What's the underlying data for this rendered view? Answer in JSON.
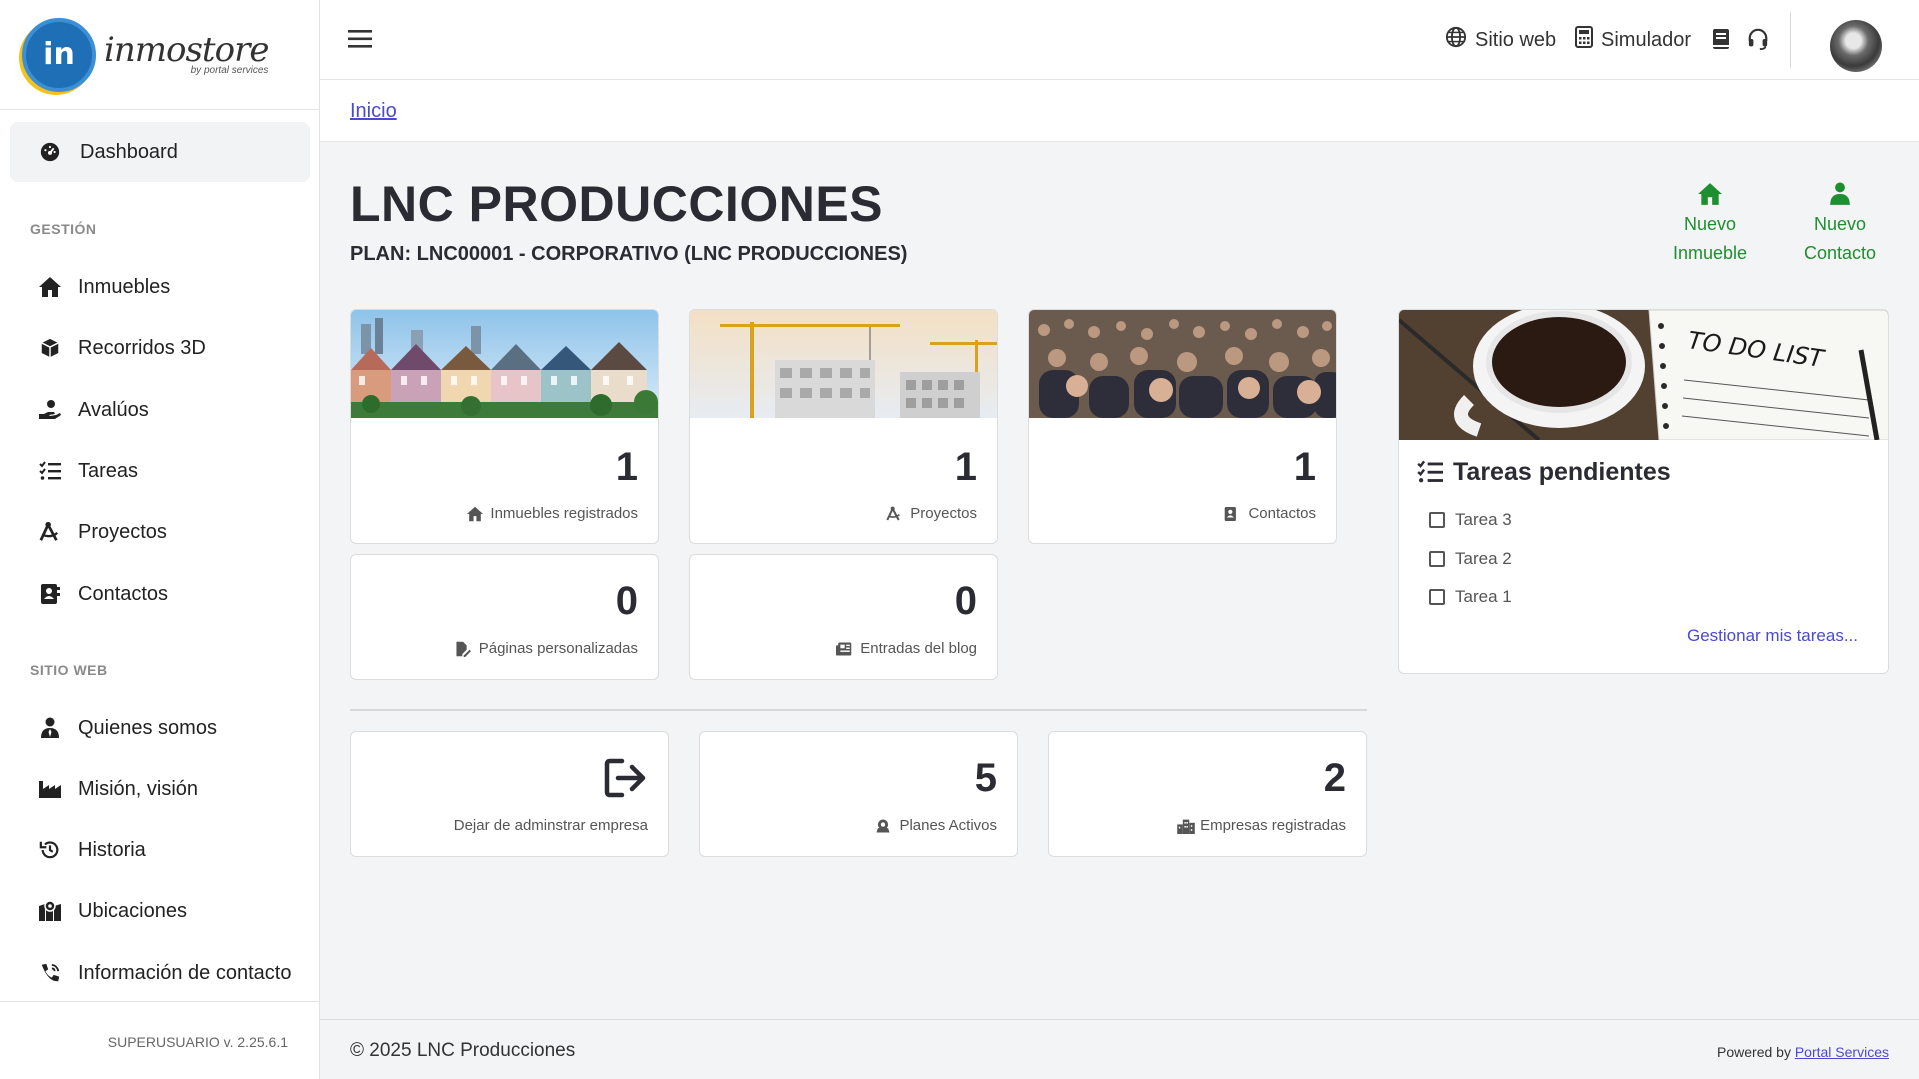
{
  "brand": {
    "logo_word": "inmostore",
    "logo_sub": "by portal services",
    "logo_mark": "in"
  },
  "sidebar": {
    "dashboard": "Dashboard",
    "section_gestion": "GESTIÓN",
    "gestion_items": [
      {
        "label": "Inmuebles",
        "icon": "home-icon"
      },
      {
        "label": "Recorridos 3D",
        "icon": "cube-icon"
      },
      {
        "label": "Avalúos",
        "icon": "hand-coin-icon"
      },
      {
        "label": "Tareas",
        "icon": "task-list-icon"
      },
      {
        "label": "Proyectos",
        "icon": "compass-drafting-icon"
      },
      {
        "label": "Contactos",
        "icon": "address-book-icon"
      }
    ],
    "section_sitio": "SITIO WEB",
    "sitio_items": [
      {
        "label": "Quienes somos",
        "icon": "user-tie-icon"
      },
      {
        "label": "Misión, visión",
        "icon": "industry-icon"
      },
      {
        "label": "Historia",
        "icon": "history-icon"
      },
      {
        "label": "Ubicaciones",
        "icon": "map-location-icon"
      },
      {
        "label": "Información de contacto",
        "icon": "phone-volume-icon"
      }
    ],
    "version": "SUPERUSUARIO v. 2.25.6.1"
  },
  "topbar": {
    "sitio_web": "Sitio web",
    "simulador": "Simulador"
  },
  "breadcrumb": "Inicio",
  "header": {
    "title": "LNC PRODUCCIONES",
    "plan": "PLAN: LNC00001 - CORPORATIVO (LNC PRODUCCIONES)",
    "nuevo_inmueble": [
      "Nuevo",
      "Inmueble"
    ],
    "nuevo_contacto": [
      "Nuevo",
      "Contacto"
    ]
  },
  "stats": {
    "inmuebles": {
      "value": "1",
      "label": "Inmuebles registrados"
    },
    "proyectos": {
      "value": "1",
      "label": "Proyectos"
    },
    "contactos": {
      "value": "1",
      "label": "Contactos"
    },
    "paginas": {
      "value": "0",
      "label": "Páginas personalizadas"
    },
    "blog": {
      "value": "0",
      "label": "Entradas del blog"
    },
    "dejar": {
      "label": "Dejar de adminstrar empresa"
    },
    "planes": {
      "value": "5",
      "label": "Planes Activos"
    },
    "empresas": {
      "value": "2",
      "label": "Empresas registradas"
    }
  },
  "tasks": {
    "image_text": "TO DO LIST",
    "title": "Tareas pendientes",
    "items": [
      "Tarea 3",
      "Tarea 2",
      "Tarea 1"
    ],
    "link": "Gestionar mis tareas..."
  },
  "footer": {
    "copyright": "© 2025 LNC Producciones",
    "powered_prefix": "Powered by",
    "powered_link": "Portal Services"
  },
  "colors": {
    "accent_green": "#1e8f2e",
    "link_blue": "#4a4ad0",
    "text_dark": "#2b2b33"
  }
}
